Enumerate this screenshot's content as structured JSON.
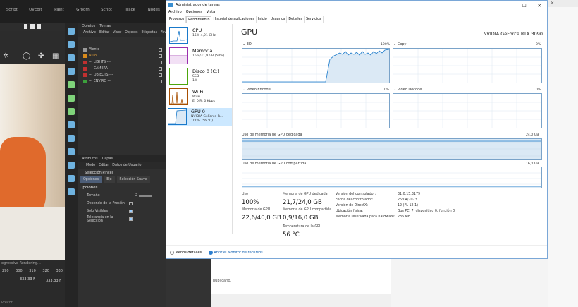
{
  "c4d": {
    "menu_tabs": [
      "Script",
      "UVEdit",
      "Paint",
      "Groom",
      "Script",
      "Track",
      "Nodes"
    ],
    "objects_tabs": [
      "Objetos",
      "Tomas"
    ],
    "objects_menu": [
      "Archivo",
      "Editar",
      "Visor",
      "Objetos",
      "Etiquetas",
      "Fav"
    ],
    "objects": [
      {
        "name": "Viento",
        "color": "#9a9a9a"
      },
      {
        "name": "Nulo",
        "color": "#d98a1a"
      },
      {
        "name": "--- LIGHTS ---",
        "color": "#c03030"
      },
      {
        "name": "--- CAMERA ---",
        "color": "#c03030"
      },
      {
        "name": "--- OBJECTS ---",
        "color": "#c03030"
      },
      {
        "name": "--- ENVIRO ---",
        "color": "#3ca03c"
      }
    ],
    "attr_tabs": [
      "Atributos",
      "Capas"
    ],
    "attr_menu": [
      "Modo",
      "Editar",
      "Datos de Usuario"
    ],
    "attr_title": "Selección Pincel",
    "attr_subtabs": [
      "Opciones",
      "Eje",
      "Selección Suave"
    ],
    "section": "Opciones",
    "rows": {
      "tamano": {
        "label": "Tamaño",
        "value": "2"
      },
      "presion": {
        "label": "Depende de la Presión"
      },
      "visibles": {
        "label": "Solo Visibles"
      },
      "tolerancia": {
        "label": "Tolerancia en la Selección"
      }
    },
    "timeline": {
      "label": "ogressive Rendering...",
      "ticks": [
        "290",
        "300",
        "310",
        "320",
        "330"
      ],
      "frame_a": "333.33 F",
      "frame_b": "333.33 F",
      "search": "Precor"
    }
  },
  "taskmgr": {
    "title": "Administrador de tareas",
    "window_buttons": {
      "minimize": "—",
      "maximize": "☐",
      "close": "✕"
    },
    "menu": [
      "Archivo",
      "Opciones",
      "Vista"
    ],
    "tabs": [
      "Procesos",
      "Rendimiento",
      "Historial de aplicaciones",
      "Inicio",
      "Usuarios",
      "Detalles",
      "Servicios"
    ],
    "active_tab": "Rendimiento",
    "resources": [
      {
        "name": "CPU",
        "sub": "15%  4,21 GHz",
        "sub2": ""
      },
      {
        "name": "Memoria",
        "sub": "15,8/31,9 GB (50%)",
        "sub2": ""
      },
      {
        "name": "Disco 0 (C:)",
        "sub": "SSD",
        "sub2": "1%"
      },
      {
        "name": "Wi-Fi",
        "sub": "Wi-Fi",
        "sub2": "E: 0  R: 0 Kbps"
      },
      {
        "name": "GPU 0",
        "sub": "NVIDIA GeForce R...",
        "sub2": "100% (56 °C)"
      }
    ],
    "gpu_title": "GPU",
    "gpu_name": "NVIDIA GeForce RTX 3090",
    "graphs": {
      "g3d": {
        "label": "3D",
        "max": "100%",
        "min": "0%"
      },
      "copy": {
        "label": "Copy",
        "max": "0%"
      },
      "encode": {
        "label": "Video Encode",
        "max": "0%"
      },
      "decode": {
        "label": "Video Decode",
        "max": "0%"
      },
      "dedicated": {
        "label": "Uso de memoria de GPU dedicada",
        "max": "24,0 GB"
      },
      "shared": {
        "label": "Uso de memoria de GPU compartida",
        "max": "16,0 GB"
      }
    },
    "stats": {
      "uso_label": "Uso",
      "uso": "100%",
      "mem_ded_label": "Memoria de GPU dedicada",
      "mem_ded": "21,7/24,0 GB",
      "mem_gpu_label": "Memoria de GPU",
      "mem_gpu": "22,6/40,0 GB",
      "mem_sh_label": "Memoria de GPU compartida",
      "mem_sh": "0,9/16,0 GB",
      "temp_label": "Temperatura de la GPU",
      "temp": "56 °C"
    },
    "info": [
      {
        "k": "Versión del controlador:",
        "v": "31.0.15.3179"
      },
      {
        "k": "Fecha del controlador:",
        "v": "25/04/2023"
      },
      {
        "k": "Versión de DirectX:",
        "v": "12 (FL 12.1)"
      },
      {
        "k": "Ubicación física:",
        "v": "Bus PCI 7, dispositivo 0, función 0"
      },
      {
        "k": "Memoria reservada para hardware:",
        "v": "236 MB"
      }
    ],
    "footer": {
      "less": "Menos detalles",
      "monitor": "Abrir el Monitor de recursos"
    }
  },
  "web": {
    "text": "publicarlo."
  },
  "colors": {
    "accent": "#1979ca",
    "graph_line": "#4a8fc9",
    "graph_fill": "#dbe9f5",
    "selected": "#cce8ff"
  }
}
